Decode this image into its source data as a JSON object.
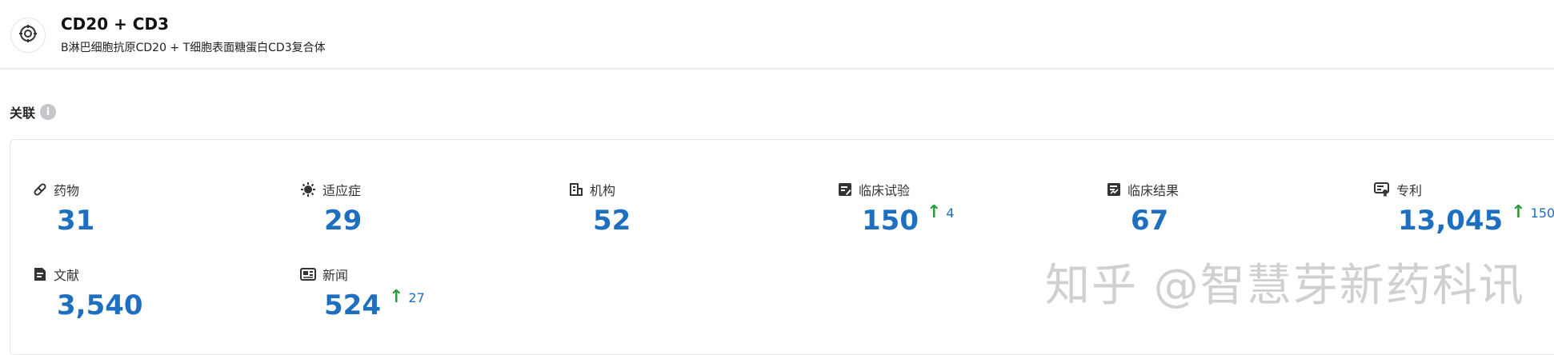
{
  "header": {
    "title": "CD20 + CD3",
    "subtitle": "B淋巴细胞抗原CD20 + T细胞表面糖蛋白CD3复合体",
    "icon": "target-icon"
  },
  "section": {
    "title": "关联",
    "info_icon": "info-icon",
    "info_glyph": "i"
  },
  "stats": [
    {
      "label": "药物",
      "value": "31",
      "icon": "pill-icon"
    },
    {
      "label": "适应症",
      "value": "29",
      "icon": "virus-icon"
    },
    {
      "label": "机构",
      "value": "52",
      "icon": "building-icon"
    },
    {
      "label": "临床试验",
      "value": "150",
      "icon": "clinical-trial-icon",
      "delta_arrow": "↑",
      "delta": "4"
    },
    {
      "label": "临床结果",
      "value": "67",
      "icon": "clinical-result-icon"
    },
    {
      "label": "专利",
      "value": "13,045",
      "icon": "patent-icon",
      "delta_arrow": "↑",
      "delta": "150"
    },
    {
      "label": "文献",
      "value": "3,540",
      "icon": "document-icon"
    },
    {
      "label": "新闻",
      "value": "524",
      "icon": "news-icon",
      "delta_arrow": "↑",
      "delta": "27"
    }
  ],
  "watermark": "知乎 @智慧芽新药科讯",
  "colors": {
    "value_blue": "#1f6fc1",
    "delta_green": "#2e9b3a",
    "icon_dark": "#333333"
  }
}
